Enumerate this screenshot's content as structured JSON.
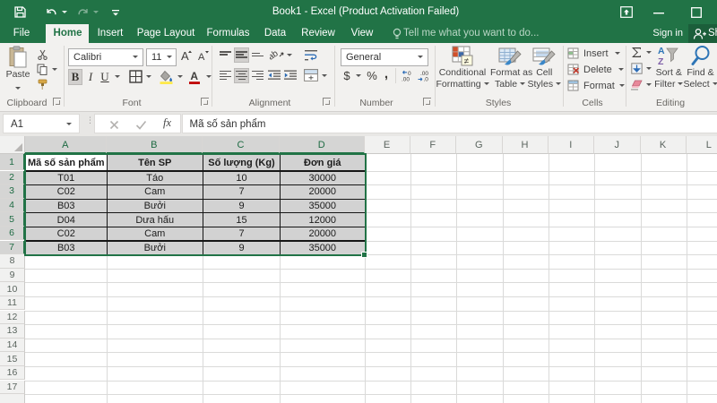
{
  "titlebar": {
    "title": "Book1 - Excel (Product Activation Failed)"
  },
  "tabrow": {
    "tabs": [
      {
        "label": "File",
        "center": 24,
        "active": false
      },
      {
        "label": "Home",
        "center": 75.5,
        "active": true
      },
      {
        "label": "Insert",
        "center": 123,
        "active": false
      },
      {
        "label": "Page Layout",
        "center": 185,
        "active": false
      },
      {
        "label": "Formulas",
        "center": 254.5,
        "active": false
      },
      {
        "label": "Data",
        "center": 307,
        "active": false
      },
      {
        "label": "Review",
        "center": 355,
        "active": false
      },
      {
        "label": "View",
        "center": 404,
        "active": false
      }
    ],
    "tellme": "Tell me what you want to do...",
    "signin": "Sign in",
    "share": "Share"
  },
  "ribbon": {
    "clipboard": {
      "label": "Clipboard",
      "paste": "Paste"
    },
    "font": {
      "label": "Font",
      "family": "Calibri",
      "size": "11",
      "bold": "B",
      "italic": "I",
      "underline": "U"
    },
    "alignment": {
      "label": "Alignment"
    },
    "number": {
      "label": "Number",
      "format": "General",
      "currency": "$",
      "percent": "%",
      "comma": ","
    },
    "styles": {
      "label": "Styles",
      "conditional_line1": "Conditional",
      "conditional_line2": "Formatting",
      "format_table_line1": "Format as",
      "format_table_line2": "Table",
      "cell_styles_line1": "Cell",
      "cell_styles_line2": "Styles"
    },
    "cells": {
      "label": "Cells",
      "insert": "Insert",
      "delete": "Delete",
      "format": "Format"
    },
    "editing": {
      "label": "Editing",
      "sort_line1": "Sort &",
      "sort_line2": "Filter",
      "find_line1": "Find &",
      "find_line2": "Select"
    }
  },
  "formulabar": {
    "namebox": "A1",
    "fx": "fx",
    "formula": "Mã số sản phẩm"
  },
  "sheet": {
    "columns": [
      "A",
      "B",
      "C",
      "D",
      "E",
      "F",
      "G",
      "H",
      "I",
      "J",
      "K",
      "L"
    ],
    "selected_columns": [
      "A",
      "B",
      "C",
      "D"
    ],
    "rows": [
      "1",
      "2",
      "3",
      "4",
      "5",
      "6",
      "7",
      "8",
      "9",
      "10",
      "11",
      "12",
      "13",
      "14",
      "15",
      "16",
      "17"
    ],
    "selected_rows": [
      "1",
      "2",
      "3",
      "4",
      "5",
      "6",
      "7"
    ],
    "active_cell": "A1",
    "table": {
      "headers": [
        "Mã số sản phẩm",
        "Tên SP",
        "Số lượng (Kg)",
        "Đơn giá"
      ],
      "rows": [
        [
          "T01",
          "Táo",
          "10",
          "30000"
        ],
        [
          "C02",
          "Cam",
          "7",
          "20000"
        ],
        [
          "B03",
          "Bưởi",
          "9",
          "35000"
        ],
        [
          "D04",
          "Dưa hấu",
          "15",
          "12000"
        ],
        [
          "C02",
          "Cam",
          "7",
          "20000"
        ],
        [
          "B03",
          "Bưởi",
          "9",
          "35000"
        ]
      ]
    }
  }
}
